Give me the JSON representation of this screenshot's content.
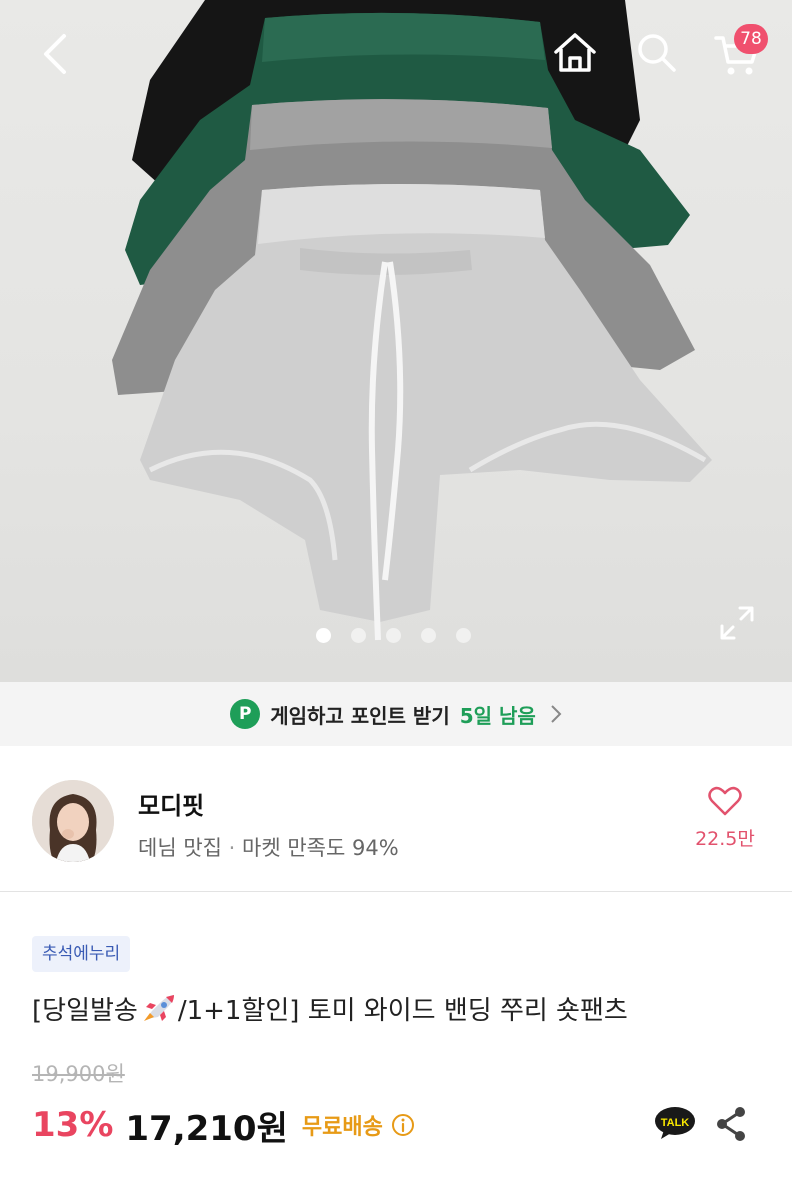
{
  "topbar": {
    "back_icon": "chevron-left-icon",
    "home_icon": "home-icon",
    "search_icon": "search-icon",
    "cart_icon": "cart-icon",
    "cart_count": "78"
  },
  "gallery": {
    "total_images": 5,
    "active_index": 1,
    "expand_icon": "expand-icon"
  },
  "banner": {
    "badge": "P",
    "text": "게임하고 포인트 받기",
    "days_left": "5일 남음"
  },
  "seller": {
    "name": "모디핏",
    "category": "데님 맛집",
    "separator": "·",
    "satisfaction": "마켓 만족도 94%",
    "like_count": "22.5만"
  },
  "product": {
    "tag": "추석에누리",
    "title_prefix": "[당일발송",
    "title_suffix": "/1+1할인] 토미 와이드 밴딩 쭈리 숏팬츠",
    "original_price": "19,900원",
    "discount": "13%",
    "price": "17,210원",
    "shipping": "무료배송",
    "talk_label": "TALK"
  },
  "colors": {
    "accent_red": "#e94560",
    "badge_pink": "#f0506e",
    "green": "#1e9e58",
    "shipping_orange": "#e79a16",
    "tag_blue": "#3a5bb4"
  }
}
